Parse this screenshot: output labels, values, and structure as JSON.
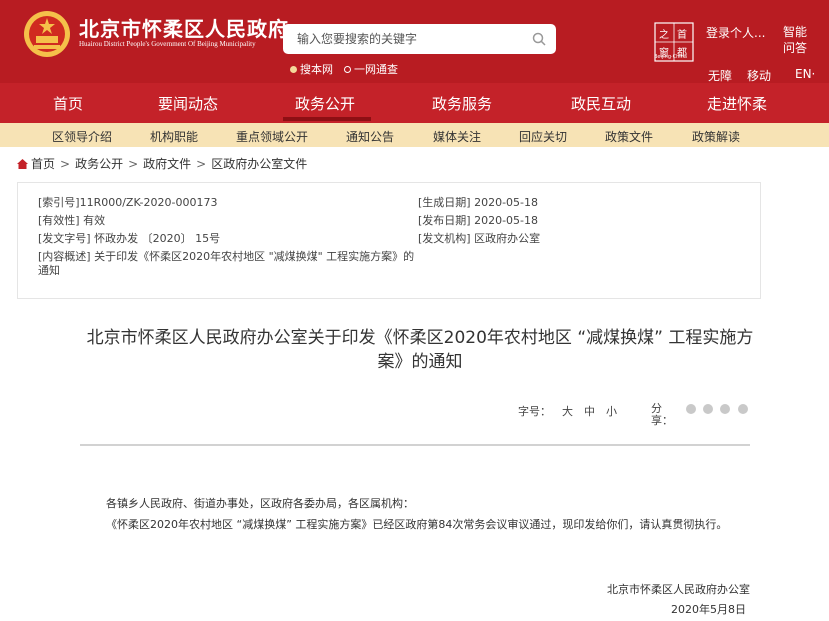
{
  "header": {
    "title": "北京市怀柔区人民政府",
    "subtitle": "Huairou District People's Government Of Beijing Municipality",
    "search_placeholder": "输入您要搜索的关键字",
    "scope_site": "搜本网",
    "scope_all": "一网通查",
    "beijing_logo_text": "首都之窗",
    "beijing_logo_sub": "Beijing·China",
    "login": "登录个人...",
    "smart_qa": "智能问答",
    "accessibility": "无障",
    "mobile": "移动",
    "english": "EN·"
  },
  "main_nav": [
    "首页",
    "要闻动态",
    "政务公开",
    "政务服务",
    "政民互动",
    "走进怀柔"
  ],
  "main_nav_active": "政务公开",
  "sub_nav": [
    "区领导介绍",
    "机构职能",
    "重点领域公开",
    "通知公告",
    "媒体关注",
    "回应关切",
    "政策文件",
    "政策解读"
  ],
  "breadcrumb": [
    "首页",
    "政务公开",
    "政府文件",
    "区政府办公室文件"
  ],
  "meta": {
    "index_no": "[索引号]11R000/ZK-2020-000173",
    "validity": "[有效性] 有效",
    "doc_no": "[发文字号] 怀政办发 〔2020〕 15号",
    "summary": "[内容概述] 关于印发《怀柔区2020年农村地区 \"减煤换煤\" 工程实施方案》的通知",
    "effective_date": "[生成日期] 2020-05-18",
    "publish_date": "[发布日期] 2020-05-18",
    "issuer": "[发文机构] 区政府办公室"
  },
  "doc": {
    "title": "北京市怀柔区人民政府办公室关于印发《怀柔区2020年农村地区 “减煤换煤” 工程实施方案》的通知",
    "font_label": "字号：",
    "font_sizes": [
      "大",
      "中",
      "小"
    ],
    "share_label": "分享：",
    "para1": "各镇乡人民政府、街道办事处，区政府各委办局，各区属机构：",
    "para2": "《怀柔区2020年农村地区 “减煤换煤” 工程实施方案》已经区政府第84次常务会议审议通过，现印发给你们，请认真贯彻执行。",
    "signer": "北京市怀柔区人民政府办公室",
    "date": "2020年5月8日"
  },
  "colors": {
    "brand_red": "#b81c22",
    "subnav_bg": "#f7e3b5"
  }
}
